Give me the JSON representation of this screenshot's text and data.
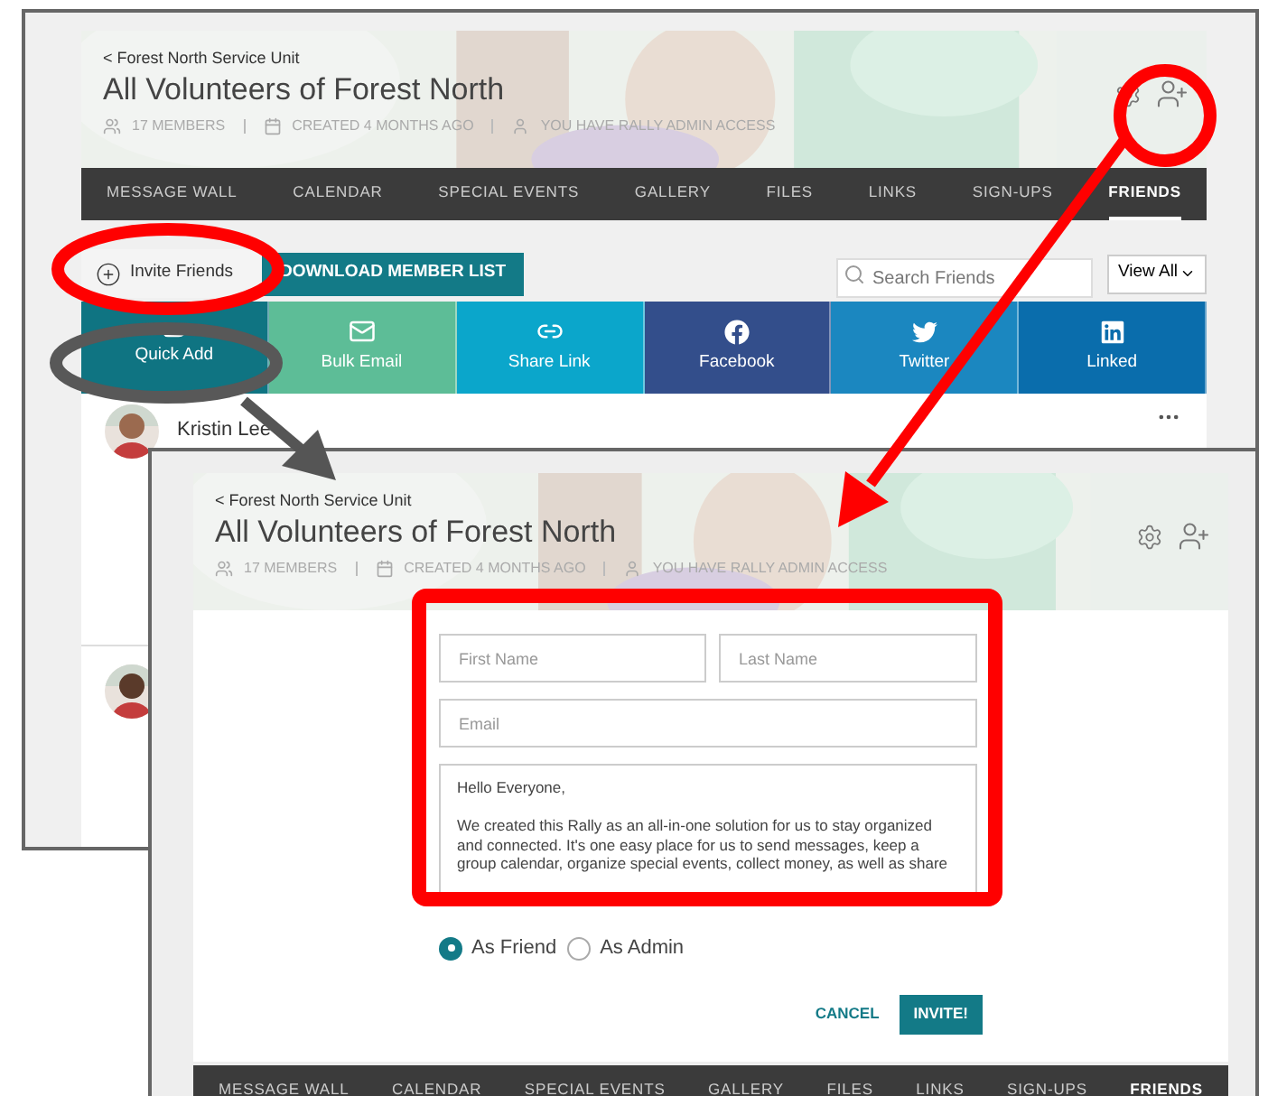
{
  "back_window": {
    "breadcrumb": "< Forest North Service Unit",
    "title": "All Volunteers of Forest North",
    "meta": [
      {
        "kind": "members",
        "label": "17 MEMBERS"
      },
      {
        "kind": "created",
        "label": "CREATED 4 MONTHS AGO"
      },
      {
        "kind": "access",
        "label": "YOU HAVE RALLY ADMIN ACCESS"
      }
    ],
    "nav": [
      {
        "label": "MESSAGE WALL",
        "selected": false
      },
      {
        "label": "CALENDAR",
        "selected": false
      },
      {
        "label": "SPECIAL EVENTS",
        "selected": false
      },
      {
        "label": "GALLERY",
        "selected": false
      },
      {
        "label": "FILES",
        "selected": false
      },
      {
        "label": "LINKS",
        "selected": false
      },
      {
        "label": "SIGN-UPS",
        "selected": false
      },
      {
        "label": "FRIENDS",
        "selected": true
      }
    ],
    "invite_button": "Invite Friends",
    "download_button": "DOWNLOAD MEMBER LIST",
    "search": {
      "placeholder": "Search Friends"
    },
    "filter": "View All",
    "share_tiles": [
      {
        "kind": "quick_add",
        "label": "Quick Add",
        "color": "#0f7482"
      },
      {
        "kind": "email",
        "label": "Bulk Email",
        "color": "#5dbd97"
      },
      {
        "kind": "link",
        "label": "Share Link",
        "color": "#0ba6cb"
      },
      {
        "kind": "facebook",
        "label": "Facebook",
        "color": "#334e8b"
      },
      {
        "kind": "twitter",
        "label": "Twitter",
        "color": "#1b87c0"
      },
      {
        "kind": "linkedin",
        "label": "Linked",
        "color": "#0a6dac"
      }
    ],
    "members": [
      {
        "name": "Kristin Lee"
      }
    ]
  },
  "front_window": {
    "breadcrumb": "< Forest North Service Unit",
    "title": "All Volunteers of Forest North",
    "meta": [
      {
        "kind": "members",
        "label": "17 MEMBERS"
      },
      {
        "kind": "created",
        "label": "CREATED 4 MONTHS AGO"
      },
      {
        "kind": "access",
        "label": "YOU HAVE RALLY ADMIN ACCESS"
      }
    ],
    "form": {
      "first_name": {
        "placeholder": "First Name"
      },
      "last_name": {
        "placeholder": "Last Name"
      },
      "email": {
        "placeholder": "Email"
      },
      "message": "Hello Everyone,\n\nWe created this Rally as an all-in-one solution for us to stay organized and connected. It's one easy place for us to send messages, keep a group calendar, organize special events, collect money, as well as share"
    },
    "roles": [
      {
        "label": "As Friend",
        "selected": true
      },
      {
        "label": "As Admin",
        "selected": false
      }
    ],
    "cancel": "CANCEL",
    "invite": "INVITE!",
    "nav": [
      {
        "label": "MESSAGE WALL",
        "selected": false
      },
      {
        "label": "CALENDAR",
        "selected": false
      },
      {
        "label": "SPECIAL EVENTS",
        "selected": false
      },
      {
        "label": "GALLERY",
        "selected": false
      },
      {
        "label": "FILES",
        "selected": false
      },
      {
        "label": "LINKS",
        "selected": false
      },
      {
        "label": "SIGN-UPS",
        "selected": false
      },
      {
        "label": "FRIENDS",
        "selected": true
      }
    ]
  }
}
